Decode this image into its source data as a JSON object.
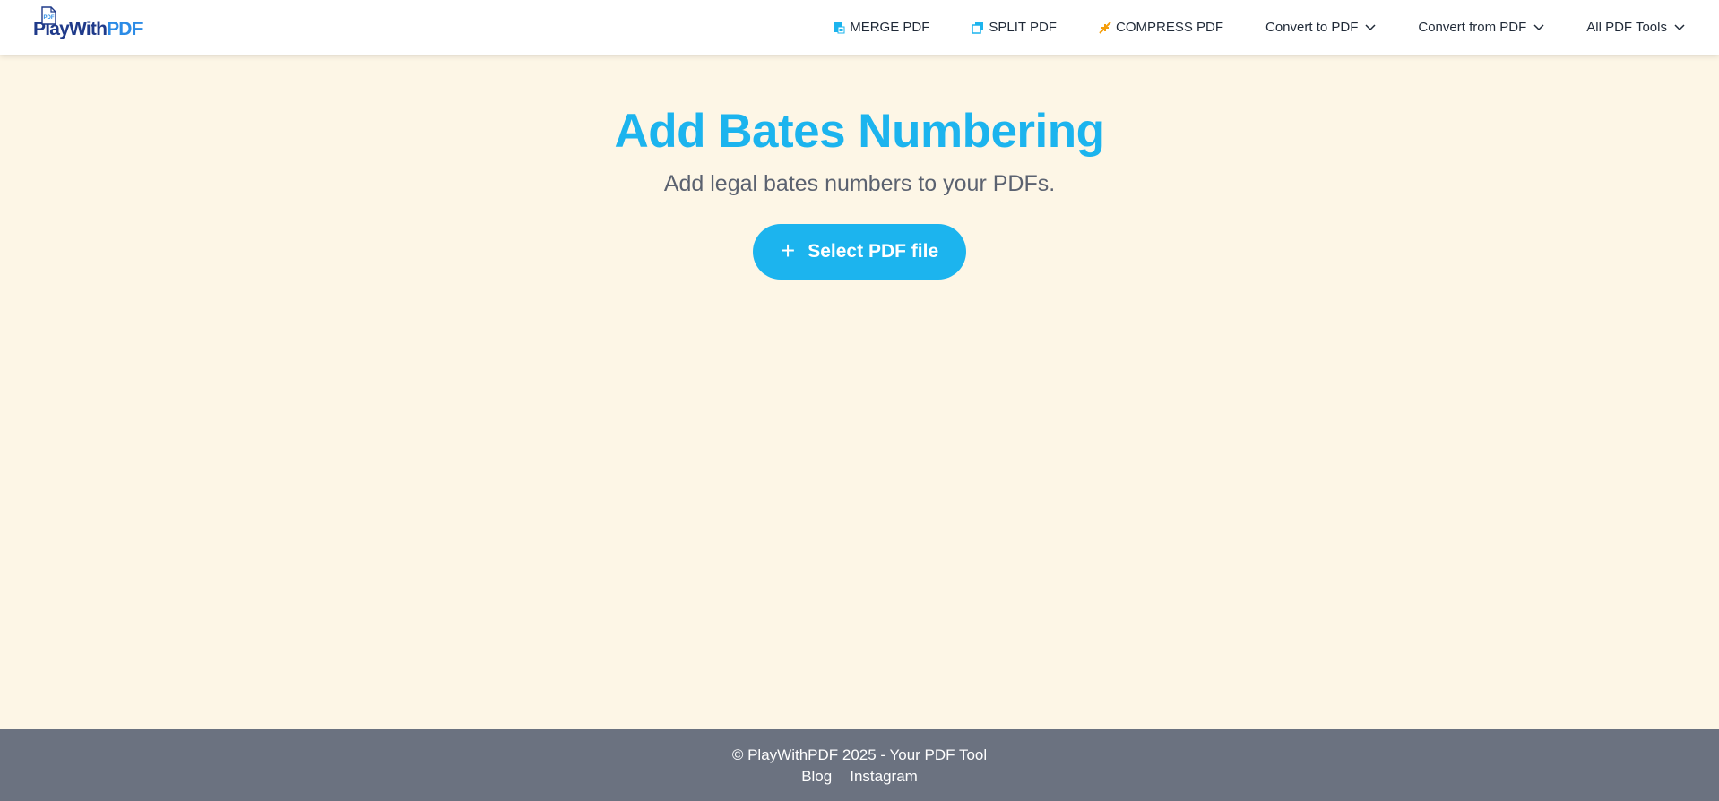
{
  "header": {
    "logo": {
      "text_main": "PlayWith",
      "text_accent": "PDF",
      "badge": "PDF"
    },
    "nav": [
      {
        "label": "MERGE PDF",
        "icon": "merge-icon"
      },
      {
        "label": "SPLIT PDF",
        "icon": "split-icon"
      },
      {
        "label": "COMPRESS PDF",
        "icon": "compress-icon"
      },
      {
        "label": "Convert to PDF",
        "icon": "chevron-down-icon"
      },
      {
        "label": "Convert from PDF",
        "icon": "chevron-down-icon"
      },
      {
        "label": "All PDF Tools",
        "icon": "chevron-down-icon"
      }
    ]
  },
  "main": {
    "title": "Add Bates Numbering",
    "subtitle": "Add legal bates numbers to your PDFs.",
    "select_button": {
      "label": "Select PDF file",
      "icon": "plus-icon"
    }
  },
  "footer": {
    "copyright": "© PlayWithPDF 2025 - Your PDF Tool",
    "links": [
      "Blog",
      "Instagram"
    ]
  },
  "colors": {
    "accent": "#1cb4ee",
    "background": "#fdf6e6",
    "footer": "#6b7280",
    "compress_icon": "#f59e0b"
  }
}
